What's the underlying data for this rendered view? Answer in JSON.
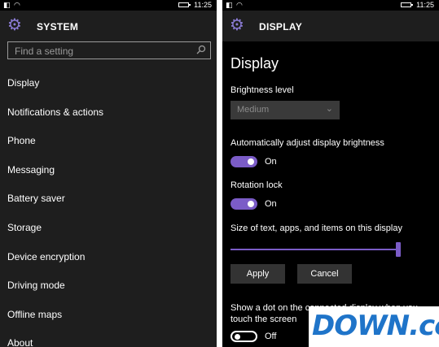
{
  "status_bar": {
    "time": "11:25"
  },
  "system": {
    "title": "SYSTEM",
    "search_placeholder": "Find a setting",
    "items": [
      {
        "label": "Display"
      },
      {
        "label": "Notifications & actions"
      },
      {
        "label": "Phone"
      },
      {
        "label": "Messaging"
      },
      {
        "label": "Battery saver"
      },
      {
        "label": "Storage"
      },
      {
        "label": "Device encryption"
      },
      {
        "label": "Driving mode"
      },
      {
        "label": "Offline maps"
      },
      {
        "label": "About"
      }
    ]
  },
  "display": {
    "header": "DISPLAY",
    "page_title": "Display",
    "brightness_label": "Brightness level",
    "brightness_value": "Medium",
    "auto_brightness_label": "Automatically adjust display brightness",
    "auto_brightness_state": "On",
    "rotation_lock_label": "Rotation lock",
    "rotation_lock_state": "On",
    "size_label": "Size of text, apps, and items on this display",
    "size_slider_fraction": 1.0,
    "apply_label": "Apply",
    "cancel_label": "Cancel",
    "dot_label": "Show a dot on the connected display when you touch the screen",
    "dot_state": "Off"
  },
  "watermark": "DOWN.cc",
  "colors": {
    "accent": "#7b5cc7",
    "gear": "#8a7bd4",
    "watermark": "#1f74c9"
  }
}
